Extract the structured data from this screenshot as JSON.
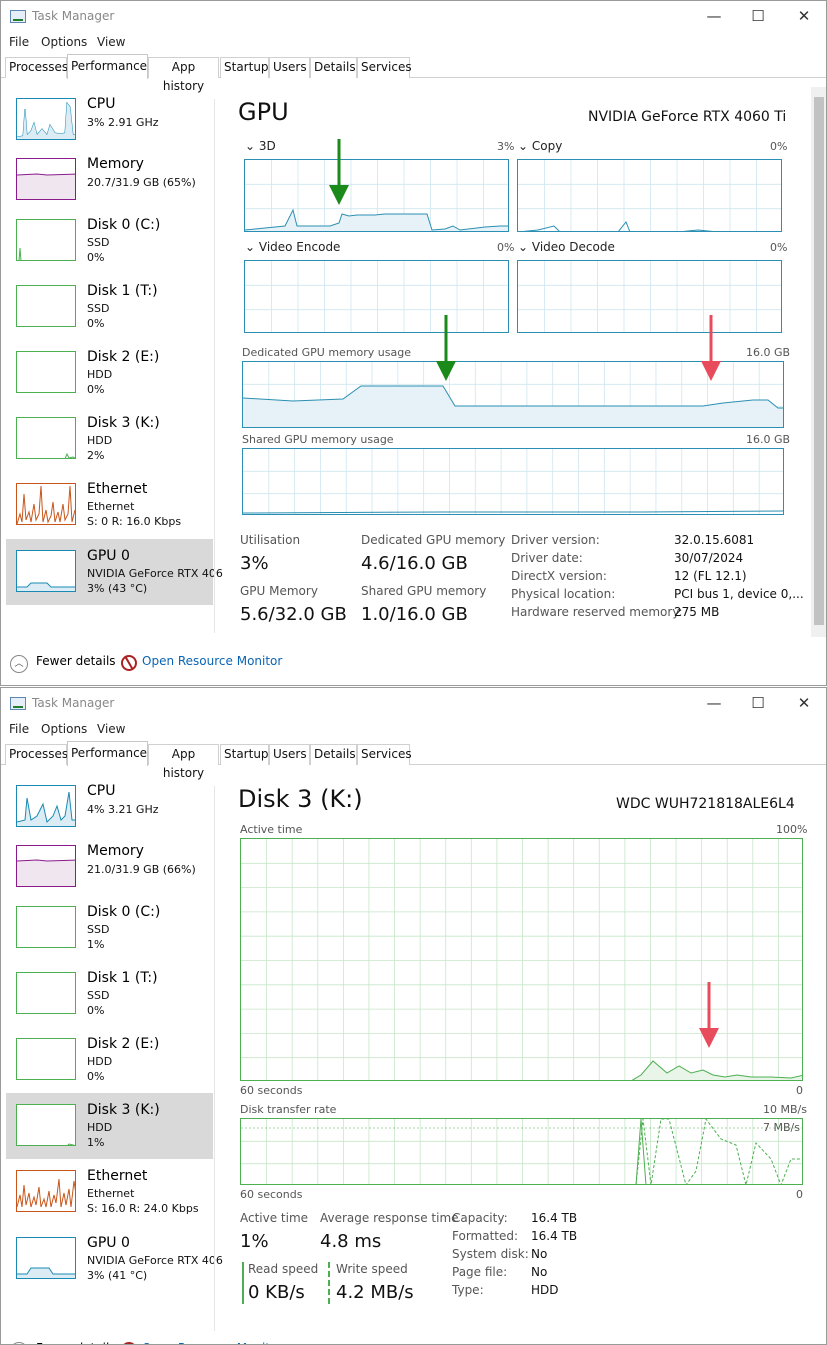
{
  "titlebar": {
    "title": "Task Manager",
    "minimize": "—",
    "maximize": "☐",
    "close": "✕"
  },
  "menu": {
    "file": "File",
    "options": "Options",
    "view": "View"
  },
  "tabs": [
    "Processes",
    "Performance",
    "App history",
    "Startup",
    "Users",
    "Details",
    "Services"
  ],
  "footer": {
    "fewer_details": "Fewer details",
    "open_resmon": "Open Resource Monitor"
  },
  "colors": {
    "cpu": "#1a8ab4",
    "memory": "#8b1a8b",
    "disk": "#4caf50",
    "ethernet": "#c8561a",
    "gpu": "#1a8ab4",
    "arrow_green": "#1a8a1a",
    "arrow_red": "#e84b5b"
  },
  "window1": {
    "sidebar": [
      {
        "name": "CPU",
        "line1": "3% 2.91 GHz",
        "line2": ""
      },
      {
        "name": "Memory",
        "line1": "20.7/31.9 GB (65%)",
        "line2": ""
      },
      {
        "name": "Disk 0 (C:)",
        "line1": "SSD",
        "line2": "0%"
      },
      {
        "name": "Disk 1 (T:)",
        "line1": "SSD",
        "line2": "0%"
      },
      {
        "name": "Disk 2 (E:)",
        "line1": "HDD",
        "line2": "0%"
      },
      {
        "name": "Disk 3 (K:)",
        "line1": "HDD",
        "line2": "2%"
      },
      {
        "name": "Ethernet",
        "line1": "Ethernet",
        "line2": "S: 0 R: 16.0 Kbps"
      },
      {
        "name": "GPU 0",
        "line1": "NVIDIA GeForce RTX 406",
        "line2": "3% (43 °C)"
      }
    ],
    "title": "GPU",
    "model": "NVIDIA GeForce RTX 4060 Ti",
    "engines": [
      {
        "name": "3D",
        "pct": "3%"
      },
      {
        "name": "Copy",
        "pct": "0%"
      },
      {
        "name": "Video Encode",
        "pct": "0%"
      },
      {
        "name": "Video Decode",
        "pct": "0%"
      }
    ],
    "dedicated_label": "Dedicated GPU memory usage",
    "dedicated_max": "16.0 GB",
    "shared_label": "Shared GPU memory usage",
    "shared_max": "16.0 GB",
    "stats": {
      "utilisation_label": "Utilisation",
      "utilisation": "3%",
      "dedicated_label": "Dedicated GPU memory",
      "dedicated": "4.6/16.0 GB",
      "gpumem_label": "GPU Memory",
      "gpumem": "5.6/32.0 GB",
      "shared_label": "Shared GPU memory",
      "shared": "1.0/16.0 GB"
    },
    "info": [
      {
        "k": "Driver version:",
        "v": "32.0.15.6081"
      },
      {
        "k": "Driver date:",
        "v": "30/07/2024"
      },
      {
        "k": "DirectX version:",
        "v": "12 (FL 12.1)"
      },
      {
        "k": "Physical location:",
        "v": "PCI bus 1, device 0,..."
      },
      {
        "k": "Hardware reserved memory:",
        "v": "275 MB"
      }
    ]
  },
  "window2": {
    "sidebar": [
      {
        "name": "CPU",
        "line1": "4% 3.21 GHz",
        "line2": ""
      },
      {
        "name": "Memory",
        "line1": "21.0/31.9 GB (66%)",
        "line2": ""
      },
      {
        "name": "Disk 0 (C:)",
        "line1": "SSD",
        "line2": "1%"
      },
      {
        "name": "Disk 1 (T:)",
        "line1": "SSD",
        "line2": "0%"
      },
      {
        "name": "Disk 2 (E:)",
        "line1": "HDD",
        "line2": "0%"
      },
      {
        "name": "Disk 3 (K:)",
        "line1": "HDD",
        "line2": "1%"
      },
      {
        "name": "Ethernet",
        "line1": "Ethernet",
        "line2": "S: 16.0 R: 24.0 Kbps"
      },
      {
        "name": "GPU 0",
        "line1": "NVIDIA GeForce RTX 406",
        "line2": "3% (41 °C)"
      }
    ],
    "title": "Disk 3 (K:)",
    "model": "WDC  WUH721818ALE6L4",
    "active_label": "Active time",
    "active_max": "100%",
    "seconds_label": "60 seconds",
    "zero": "0",
    "transfer_label": "Disk transfer rate",
    "transfer_max": "10 MB/s",
    "transfer_mid": "7 MB/s",
    "stats": {
      "active_label": "Active time",
      "active": "1%",
      "resp_label": "Average response time",
      "resp": "4.8 ms",
      "read_label": "Read speed",
      "read": "0 KB/s",
      "write_label": "Write speed",
      "write": "4.2 MB/s"
    },
    "info": [
      {
        "k": "Capacity:",
        "v": "16.4 TB"
      },
      {
        "k": "Formatted:",
        "v": "16.4 TB"
      },
      {
        "k": "System disk:",
        "v": "No"
      },
      {
        "k": "Page file:",
        "v": "No"
      },
      {
        "k": "Type:",
        "v": "HDD"
      }
    ]
  }
}
